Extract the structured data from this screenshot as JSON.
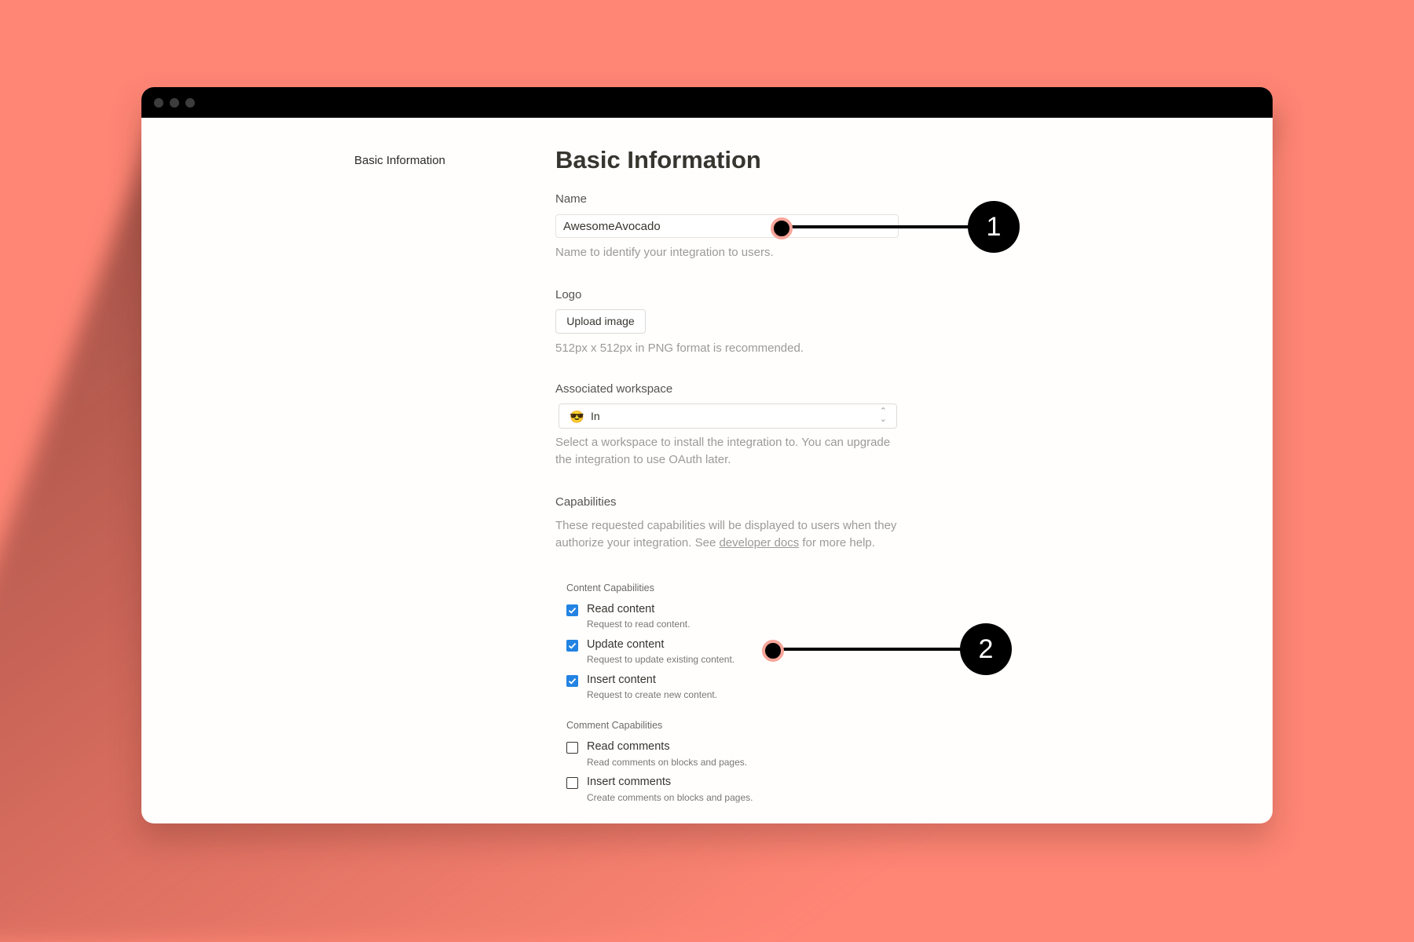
{
  "window": {
    "controls": [
      "close",
      "minimize",
      "maximize"
    ]
  },
  "sidebar": {
    "items": [
      {
        "label": "Basic Information"
      }
    ]
  },
  "main": {
    "title": "Basic Information",
    "name": {
      "label": "Name",
      "value": "AwesomeAvocado",
      "hint": "Name to identify your integration to users."
    },
    "logo": {
      "label": "Logo",
      "button": "Upload image",
      "hint": "512px x 512px in PNG format is recommended."
    },
    "workspace": {
      "label": "Associated workspace",
      "selected_icon": "😎",
      "selected": "In",
      "hint": "Select a workspace to install the integration to. You can upgrade the integration to use OAuth later."
    },
    "capabilities": {
      "label": "Capabilities",
      "desc_before": "These requested capabilities will be displayed to users when they authorize your integration. See ",
      "desc_link": "developer docs",
      "desc_after": " for more help.",
      "groups": [
        {
          "title": "Content Capabilities",
          "items": [
            {
              "label": "Read content",
              "sub": "Request to read content.",
              "checked": true
            },
            {
              "label": "Update content",
              "sub": "Request to update existing content.",
              "checked": true
            },
            {
              "label": "Insert content",
              "sub": "Request to create new content.",
              "checked": true
            }
          ]
        },
        {
          "title": "Comment Capabilities",
          "items": [
            {
              "label": "Read comments",
              "sub": "Read comments on blocks and pages.",
              "checked": false
            },
            {
              "label": "Insert comments",
              "sub": "Create comments on blocks and pages.",
              "checked": false
            }
          ]
        }
      ]
    }
  },
  "callouts": [
    {
      "number": "1"
    },
    {
      "number": "2"
    }
  ],
  "colors": {
    "background": "#ff8675",
    "accent": "#2383e2",
    "callout_ring": "#f8a59a"
  }
}
